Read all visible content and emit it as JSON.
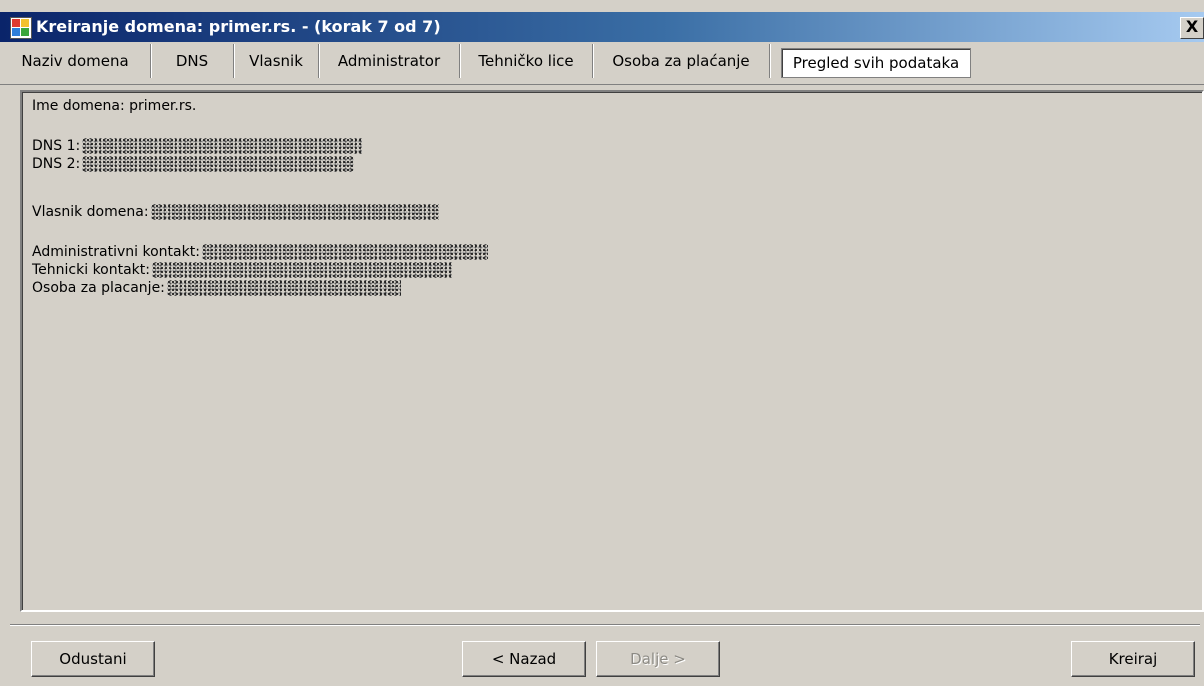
{
  "window": {
    "title": "Kreiranje domena: primer.rs. - (korak 7 od 7)",
    "close_label": "X"
  },
  "tabs": [
    {
      "label": "Naziv domena"
    },
    {
      "label": "DNS"
    },
    {
      "label": "Vlasnik"
    },
    {
      "label": "Administrator"
    },
    {
      "label": "Tehničko lice"
    },
    {
      "label": "Osoba za plaćanje"
    },
    {
      "label": "Pregled svih podataka",
      "active": true
    }
  ],
  "summary": {
    "domain_label": "Ime domena: primer.rs.",
    "dns1_label": "DNS 1:",
    "dns2_label": "DNS 2:",
    "owner_label": "Vlasnik domena:",
    "admin_label": "Administrativni kontakt:",
    "tech_label": "Tehnicki kontakt:",
    "billing_label": "Osoba za placanje:"
  },
  "buttons": {
    "cancel": "Odustani",
    "back": "< Nazad",
    "next": "Dalje >",
    "create": "Kreiraj"
  }
}
